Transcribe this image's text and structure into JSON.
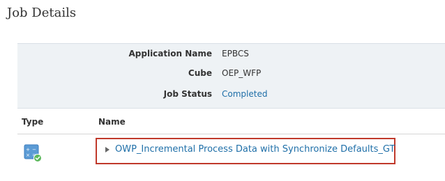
{
  "page": {
    "title": "Job Details"
  },
  "details": {
    "application_name": {
      "label": "Application Name",
      "value": "EPBCS"
    },
    "cube": {
      "label": "Cube",
      "value": "OEP_WFP"
    },
    "job_status": {
      "label": "Job Status",
      "value": "Completed"
    }
  },
  "table": {
    "columns": {
      "type": "Type",
      "name": "Name"
    },
    "rows": [
      {
        "type_icon": "calculation-success-icon",
        "name": "OWP_Incremental Process Data with Synchronize Defaults_GT"
      }
    ]
  },
  "colors": {
    "link": "#1f6fa8",
    "highlight": "#c0392b",
    "panel": "#eef2f5",
    "status_ok": "#5cb85c"
  }
}
